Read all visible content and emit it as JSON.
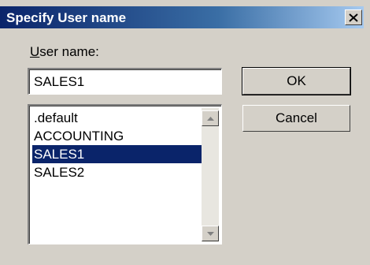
{
  "window": {
    "title": "Specify User name",
    "close_icon": "close-icon"
  },
  "form": {
    "user_label_accel": "U",
    "user_label_rest": "ser name:",
    "user_value": "SALES1"
  },
  "list": {
    "items": [
      ".default",
      "ACCOUNTING",
      "SALES1",
      "SALES2"
    ],
    "selected": "SALES1"
  },
  "buttons": {
    "ok": "OK",
    "cancel": "Cancel"
  },
  "colors": {
    "selection": "#0a246a",
    "face": "#d4d0c8"
  }
}
